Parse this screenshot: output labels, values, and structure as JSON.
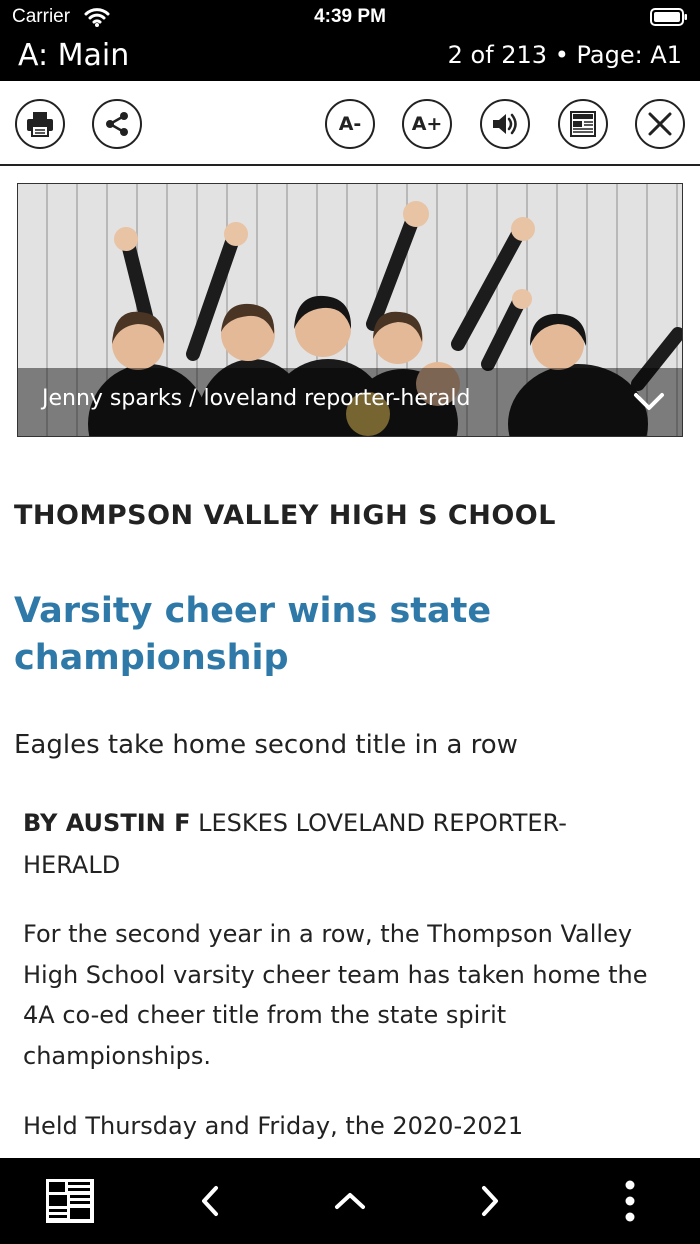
{
  "status_bar": {
    "carrier": "Carrier",
    "time": "4:39 PM"
  },
  "header": {
    "section_title": "A: Main",
    "page_indicator": "2 of 213 • Page: A1"
  },
  "toolbar": {
    "font_decrease_label": "A-",
    "font_increase_label": "A+",
    "icons": [
      "print-icon",
      "share-icon",
      "font-decrease-icon",
      "font-increase-icon",
      "speaker-icon",
      "newspaper-icon",
      "close-icon"
    ]
  },
  "photo": {
    "caption": "Jenny sparks / loveland reporter-herald"
  },
  "article": {
    "kicker": "THOMPSON VALLEY HIGH S CHOOL",
    "headline": "Varsity cheer wins state championship",
    "subhead": "Eagles take home second title in a row",
    "byline_bold": "BY AUSTIN F",
    "byline_rest": " LESKES LOVELAND REPORTER-HERALD",
    "paragraphs": [
      "For the second year in a row, the Thompson Valley High School varsity cheer team has taken home the 4A co-ed cheer title from the state spirit championships.",
      "Held Thursday and Friday, the 2020-2021"
    ]
  },
  "bottom_bar": {
    "icons": [
      "newspaper-icon",
      "chevron-left-icon",
      "chevron-up-icon",
      "chevron-right-icon",
      "more-vertical-icon"
    ]
  },
  "colors": {
    "headline": "#2e79a8",
    "bars": "#000000"
  }
}
